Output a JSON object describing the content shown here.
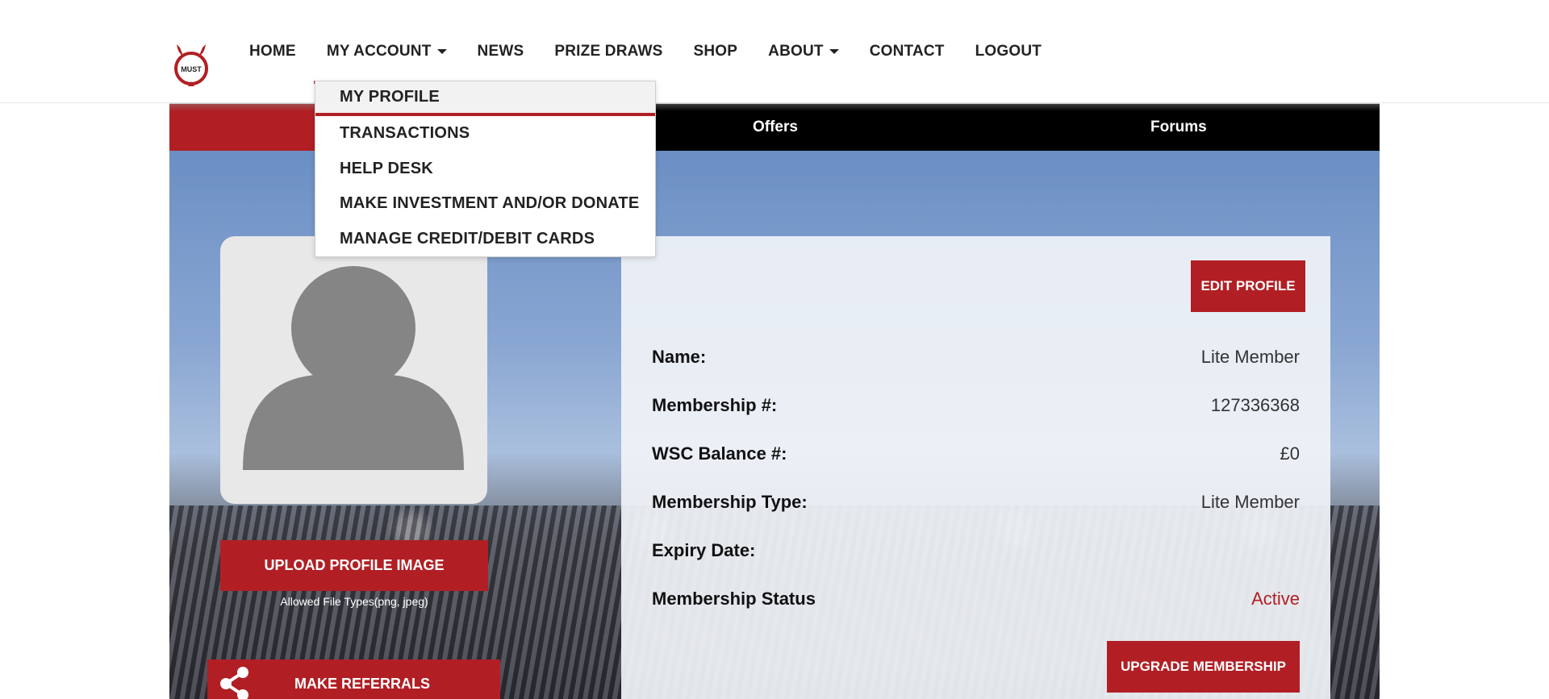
{
  "header": {
    "logo_text": "MUST",
    "nav": [
      {
        "label": "HOME"
      },
      {
        "label": "MY ACCOUNT",
        "dropdown": true,
        "active": true
      },
      {
        "label": "NEWS"
      },
      {
        "label": "PRIZE DRAWS"
      },
      {
        "label": "SHOP"
      },
      {
        "label": "ABOUT",
        "dropdown": true
      },
      {
        "label": "CONTACT"
      },
      {
        "label": "LOGOUT"
      }
    ]
  },
  "my_account_menu": {
    "items": [
      "MY PROFILE",
      "TRANSACTIONS",
      "HELP DESK",
      "MAKE INVESTMENT AND/OR DONATE",
      "MANAGE CREDIT/DEBIT CARDS"
    ],
    "highlighted": "MY PROFILE"
  },
  "subbar": {
    "items": [
      "Offers",
      "Forums"
    ]
  },
  "profile": {
    "upload_label": "UPLOAD PROFILE IMAGE",
    "allowed_types": "Allowed File Types(png, jpeg)",
    "referrals_label": "MAKE REFERRALS",
    "edit_label": "EDIT PROFILE",
    "upgrade_label": "UPGRADE MEMBERSHIP",
    "fields": [
      {
        "label": "Name:",
        "value": "Lite Member"
      },
      {
        "label": "Membership #:",
        "value": "127336368"
      },
      {
        "label": "WSC Balance #:",
        "value": "£0"
      },
      {
        "label": "Membership Type:",
        "value": "Lite Member"
      },
      {
        "label": "Expiry Date:",
        "value": ""
      },
      {
        "label": "Membership Status",
        "value": "Active"
      }
    ]
  },
  "colors": {
    "brand_red": "#b11f24",
    "status_active": "#b11f24"
  },
  "icons": [
    "devil-logo-icon",
    "caret-down-icon",
    "user-silhouette-icon",
    "share-icon"
  ]
}
